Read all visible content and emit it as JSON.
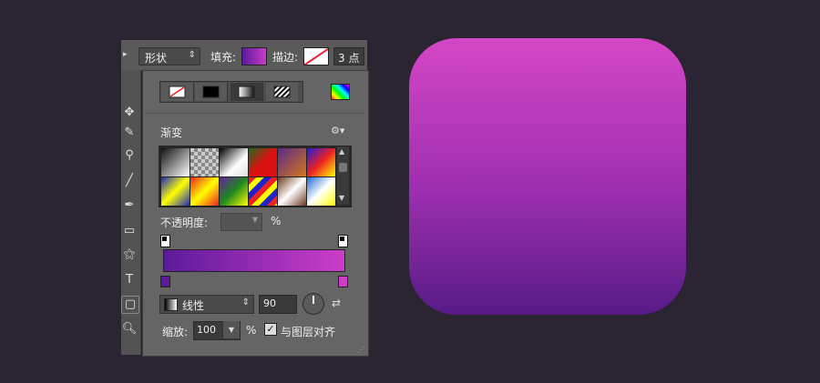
{
  "toolbar": {
    "shape_mode": "形状",
    "fill_label": "填充:",
    "stroke_label": "描边:",
    "stroke_size": "3 点"
  },
  "panel": {
    "section_title": "渐变",
    "opacity_label": "不透明度:",
    "opacity_unit": "%",
    "style_value": "线性",
    "angle_value": "90",
    "scale_label": "缩放:",
    "scale_value": "100",
    "scale_unit": "%",
    "align_label": "与图层对齐"
  },
  "colors": {
    "gradient_start": "#5c1a9c",
    "gradient_end": "#cc3ec8",
    "preview_top": "#d447c6",
    "preview_bottom": "#571b86"
  },
  "presets": [
    "linear-gradient(135deg,#111,#fff)",
    "repeating-conic-gradient(#888 0 25%,#ccc 0 50%) 0 0/8px 8px",
    "linear-gradient(135deg,#000,#fff 60%,#ddd)",
    "linear-gradient(135deg,#1a6b1a,#d11,#d11)",
    "linear-gradient(135deg,#5a2a8a,#d4761a)",
    "linear-gradient(135deg,#1d1dd6,#e22,#ff0)",
    "linear-gradient(135deg,#1b2ac2,#ff0,#1b2ac2)",
    "linear-gradient(135deg,#e22,#ff0,#e22)",
    "linear-gradient(135deg,#6a1e9e,#1e8a1e,#ff0)",
    "repeating-linear-gradient(135deg,#e22 0 6px,#ff0 6px 12px,#22c 12px 18px)",
    "linear-gradient(135deg,#6b3a1e,#fff,#6b3a1e)",
    "linear-gradient(135deg,#1f6ad6,#fff,#ff0)"
  ],
  "icons": {
    "tools": [
      "move-icon",
      "brush-icon",
      "eyedropper-icon",
      "line-icon",
      "pen-icon",
      "rectangle-icon",
      "magic-wand-icon",
      "type-icon",
      "rounded-rectangle-icon",
      "zoom-icon"
    ],
    "gear": "gear-icon",
    "reverse": "reverse-icon"
  }
}
